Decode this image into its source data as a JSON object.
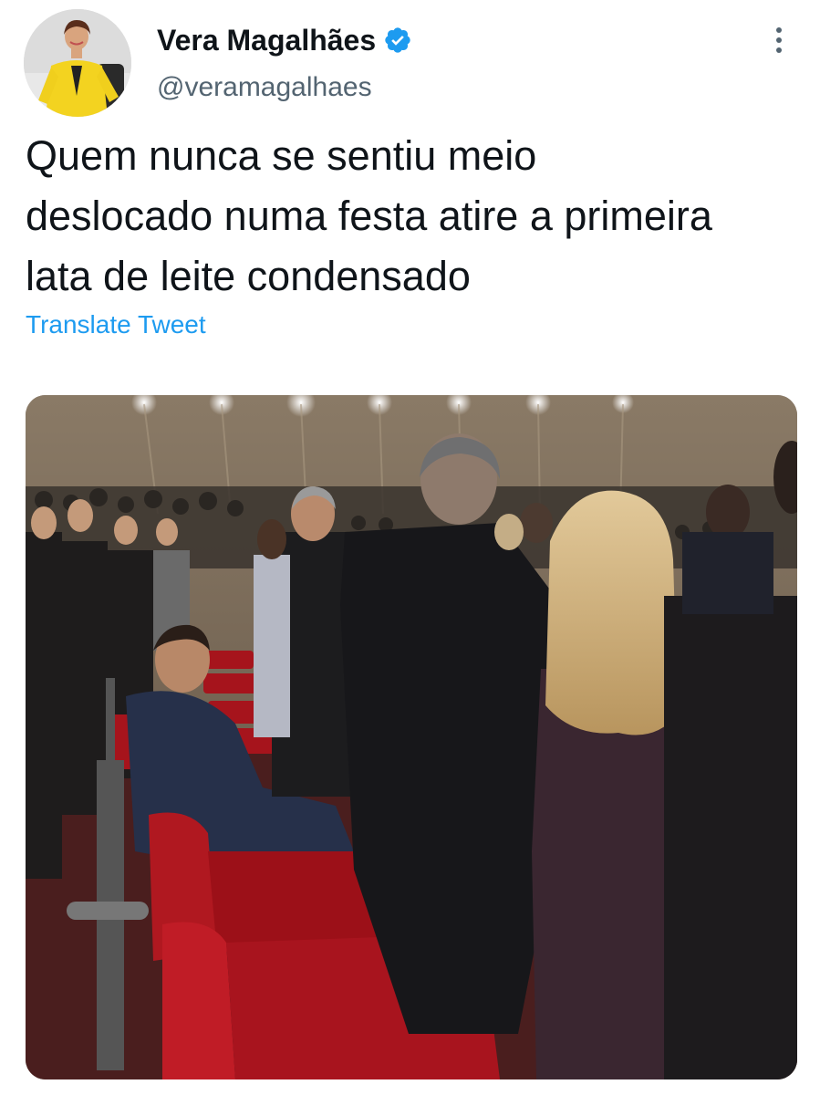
{
  "author": {
    "display_name": "Vera Magalhães",
    "handle": "@veramagalhaes",
    "verified": true,
    "avatar_icon": "profile-photo-icon"
  },
  "tweet": {
    "text": "Quem nunca se sentiu meio\ndeslocado numa festa atire a primeira\nlata de leite condensado",
    "translate_label": "Translate Tweet"
  },
  "media": {
    "type": "photo",
    "description_icon": "photo-auditorium-icon"
  },
  "colors": {
    "verified": "#1d9bf0",
    "link": "#1d9bf0",
    "secondary_text": "#536471",
    "primary_text": "#0f1419"
  },
  "icons": {
    "verified": "verified-badge-icon",
    "more": "more-options-icon"
  }
}
